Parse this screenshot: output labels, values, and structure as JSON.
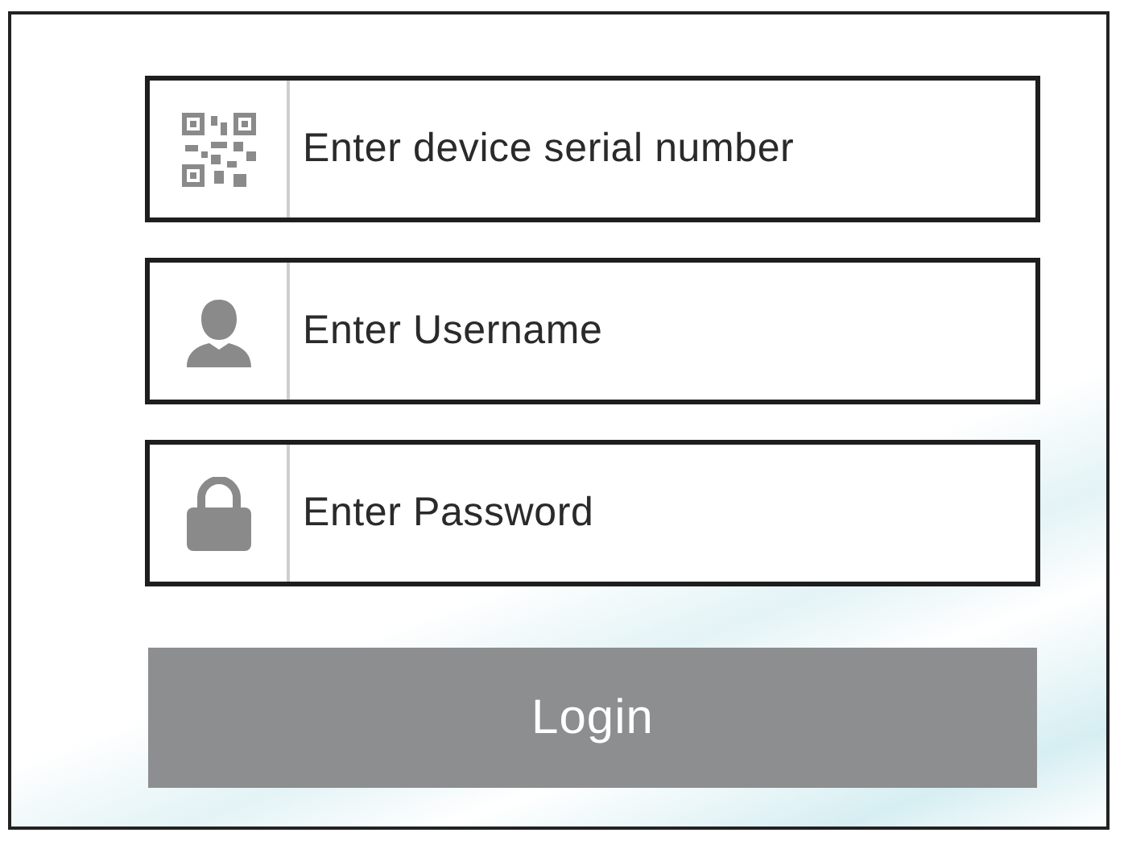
{
  "fields": [
    {
      "kind": "qr",
      "placeholder": "Enter device serial number"
    },
    {
      "kind": "user",
      "placeholder": "Enter Username"
    },
    {
      "kind": "lock",
      "placeholder": "Enter Password"
    }
  ],
  "login_button": {
    "label": "Login"
  }
}
